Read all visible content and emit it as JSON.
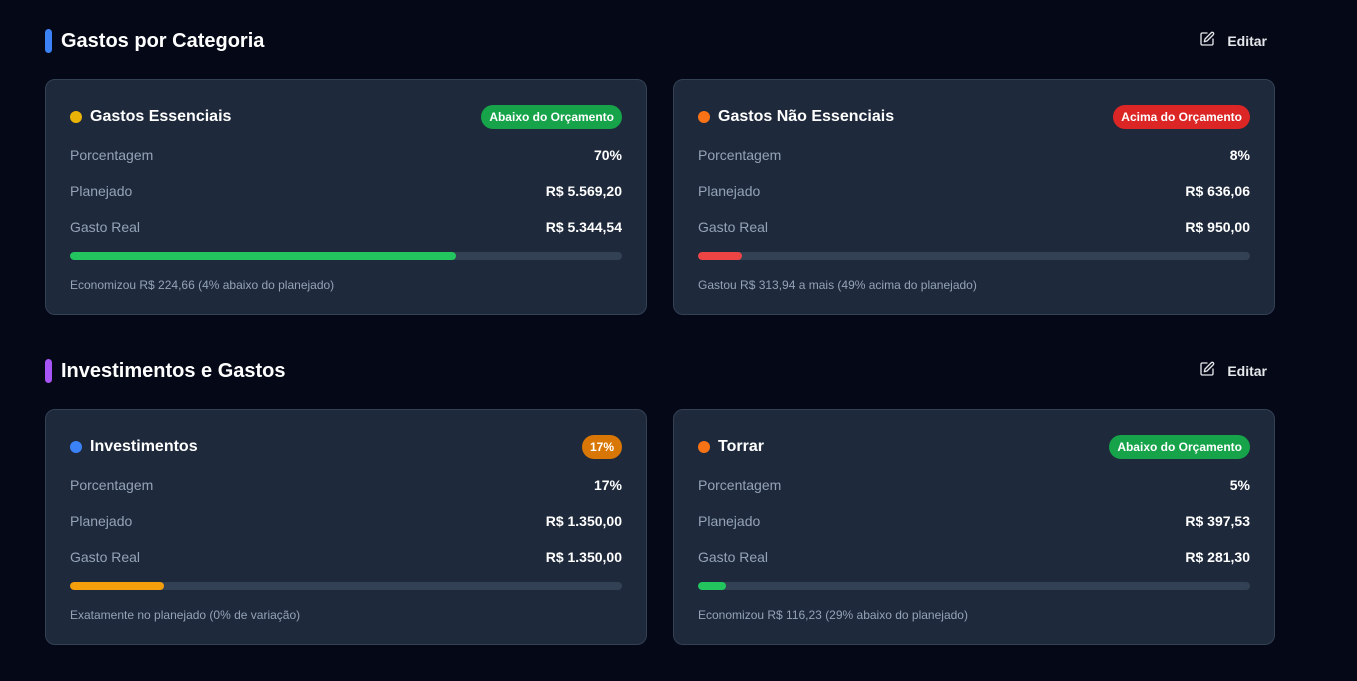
{
  "sections": [
    {
      "title": "Gastos por Categoria",
      "accent_color": "#3b82f6",
      "edit_label": "Editar",
      "cards": [
        {
          "title": "Gastos Essenciais",
          "dot_color": "#eab308",
          "badge": "Abaixo do Orçamento",
          "badge_color": "#16a34a",
          "rows": [
            {
              "label": "Porcentagem",
              "value": "70%"
            },
            {
              "label": "Planejado",
              "value": "R$ 5.569,20"
            },
            {
              "label": "Gasto Real",
              "value": "R$ 5.344,54"
            }
          ],
          "progress_pct": 70,
          "progress_color": "#22c55e",
          "note": "Economizou R$ 224,66 (4% abaixo do planejado)"
        },
        {
          "title": "Gastos Não Essenciais",
          "dot_color": "#f97316",
          "badge": "Acima do Orçamento",
          "badge_color": "#dc2626",
          "rows": [
            {
              "label": "Porcentagem",
              "value": "8%"
            },
            {
              "label": "Planejado",
              "value": "R$ 636,06"
            },
            {
              "label": "Gasto Real",
              "value": "R$ 950,00"
            }
          ],
          "progress_pct": 8,
          "progress_color": "#ef4444",
          "note": "Gastou R$ 313,94 a mais (49% acima do planejado)"
        }
      ]
    },
    {
      "title": "Investimentos e Gastos",
      "accent_color": "#a855f7",
      "edit_label": "Editar",
      "cards": [
        {
          "title": "Investimentos",
          "dot_color": "#3b82f6",
          "badge": "17%",
          "badge_color": "#d97706",
          "rows": [
            {
              "label": "Porcentagem",
              "value": "17%"
            },
            {
              "label": "Planejado",
              "value": "R$ 1.350,00"
            },
            {
              "label": "Gasto Real",
              "value": "R$ 1.350,00"
            }
          ],
          "progress_pct": 17,
          "progress_color": "#f59e0b",
          "note": "Exatamente no planejado (0% de variação)"
        },
        {
          "title": "Torrar",
          "dot_color": "#f97316",
          "badge": "Abaixo do Orçamento",
          "badge_color": "#16a34a",
          "rows": [
            {
              "label": "Porcentagem",
              "value": "5%"
            },
            {
              "label": "Planejado",
              "value": "R$ 397,53"
            },
            {
              "label": "Gasto Real",
              "value": "R$ 281,30"
            }
          ],
          "progress_pct": 5,
          "progress_color": "#22c55e",
          "note": "Economizou R$ 116,23 (29% abaixo do planejado)"
        }
      ]
    }
  ]
}
